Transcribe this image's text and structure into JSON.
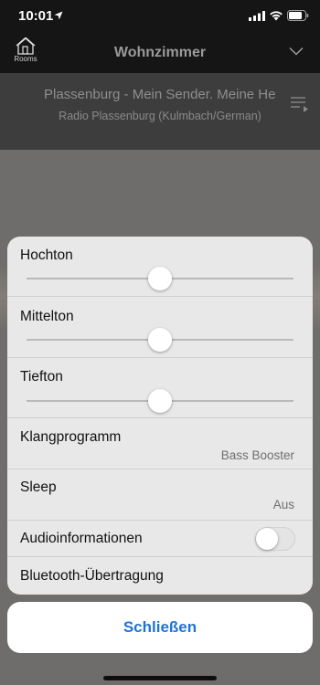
{
  "status_bar": {
    "time": "10:01",
    "icons": [
      "location-arrow-icon",
      "signal-icon",
      "wifi-icon",
      "battery-icon"
    ]
  },
  "header": {
    "rooms_label": "Rooms",
    "room_name": "Wohnzimmer",
    "icons": [
      "house-icon",
      "chevron-down-icon"
    ]
  },
  "now_playing": {
    "title": "Plassenburg - Mein Sender. Meine Heimat.",
    "station": "Radio Plassenburg (Kulmbach/German)",
    "queue_icon": "queue-list-icon"
  },
  "sound_sheet": {
    "sliders": [
      {
        "label": "Hochton",
        "value": 0.5
      },
      {
        "label": "Mittelton",
        "value": 0.5
      },
      {
        "label": "Tiefton",
        "value": 0.5
      }
    ],
    "sound_program": {
      "label": "Klangprogramm",
      "value": "Bass Booster"
    },
    "sleep": {
      "label": "Sleep",
      "value": "Aus"
    },
    "audio_info": {
      "label": "Audioinformationen",
      "enabled": false
    },
    "bluetooth": {
      "label": "Bluetooth-Übertragung"
    }
  },
  "close_button": {
    "label": "Schließen"
  },
  "colors": {
    "accent": "#1f73d6",
    "sheet_background": "#e8e8e8",
    "header_background": "#151515"
  }
}
